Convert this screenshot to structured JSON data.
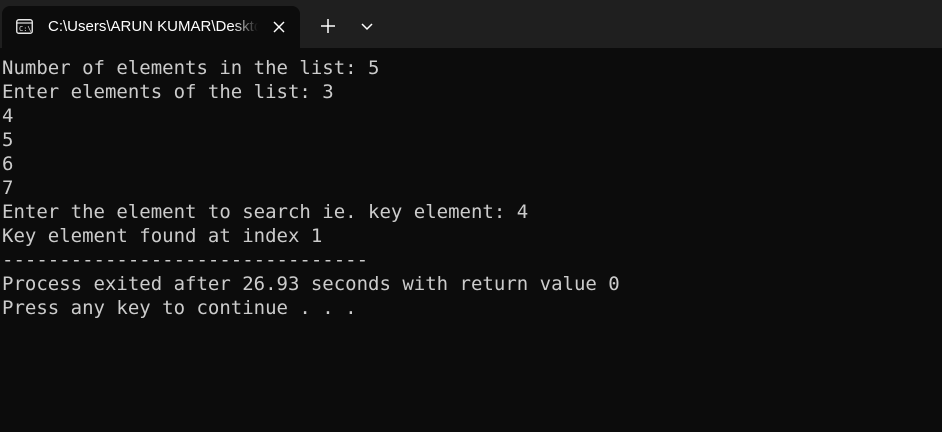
{
  "tab": {
    "title": "C:\\Users\\ARUN KUMAR\\Desktop",
    "icon": "terminal-icon"
  },
  "toolbar": {
    "new_tab_icon": "plus-icon",
    "dropdown_icon": "chevron-down-icon"
  },
  "console": {
    "lines": [
      "Number of elements in the list: 5",
      "Enter elements of the list: 3",
      "4",
      "5",
      "6",
      "7",
      "Enter the element to search ie. key element: 4",
      "Key element found at index 1",
      "--------------------------------",
      "Process exited after 26.93 seconds with return value 0",
      "Press any key to continue . . ."
    ]
  },
  "colors": {
    "background": "#0c0c0c",
    "titlebar": "#1f1f1f",
    "text": "#cccccc"
  }
}
